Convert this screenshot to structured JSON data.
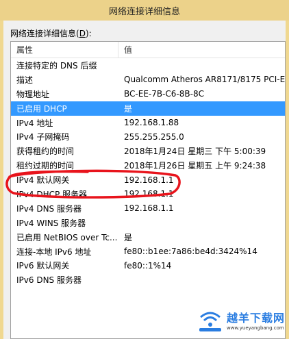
{
  "window": {
    "title": "网络连接详细信息"
  },
  "group": {
    "label": "网络连接详细信息(",
    "accel": "D",
    "label_suffix": "):"
  },
  "table": {
    "columns": [
      "属性",
      "值"
    ],
    "rows": [
      {
        "property": "连接特定的 DNS 后缀",
        "value": ""
      },
      {
        "property": "描述",
        "value": "Qualcomm Atheros AR8171/8175 PCI-E"
      },
      {
        "property": "物理地址",
        "value": "BC-EE-7B-C6-8B-8C"
      },
      {
        "property": "已启用 DHCP",
        "value": "是"
      },
      {
        "property": "IPv4 地址",
        "value": "192.168.1.88"
      },
      {
        "property": "IPv4 子网掩码",
        "value": "255.255.255.0"
      },
      {
        "property": "获得租约的时间",
        "value": "2018年1月24日 星期三 下午 5:00:39"
      },
      {
        "property": "租约过期的时间",
        "value": "2018年1月26日 星期五 上午 9:24:38"
      },
      {
        "property": "IPv4 默认网关",
        "value": "192.168.1.1"
      },
      {
        "property": "IPv4 DHCP 服务器",
        "value": "192.168.1.1"
      },
      {
        "property": "IPv4 DNS 服务器",
        "value": "192.168.1.1"
      },
      {
        "property": "IPv4 WINS 服务器",
        "value": ""
      },
      {
        "property": "已启用 NetBIOS over Tc...",
        "value": "是"
      },
      {
        "property": "连接-本地 IPv6 地址",
        "value": "fe80::b1ee:7a86:be4d:3424%14"
      },
      {
        "property": "IPv6 默认网关",
        "value": "fe80::1%14"
      },
      {
        "property": "IPv6 DNS 服务器",
        "value": ""
      }
    ],
    "selected_row": 3
  },
  "annotation": {
    "color": "#e8141c"
  },
  "watermark": {
    "main": "越羊下载网",
    "sub": "www.yueyangbang.com",
    "color": "#2a7de1"
  }
}
